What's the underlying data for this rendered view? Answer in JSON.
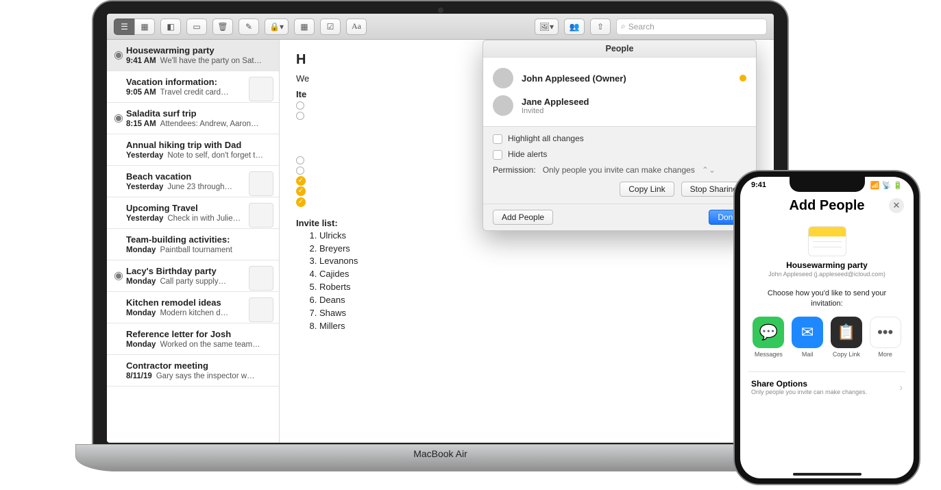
{
  "macbook_label": "MacBook Air",
  "toolbar": {
    "search_placeholder": "Search"
  },
  "sidebar": [
    {
      "title": "Housewarming party",
      "time": "9:41 AM",
      "snippet": "We'll have the party on Sat…",
      "shared": true,
      "selected": true,
      "thumb": false
    },
    {
      "title": "Vacation information:",
      "time": "9:05 AM",
      "snippet": "Travel credit card…",
      "shared": false,
      "thumb": true
    },
    {
      "title": "Saladita surf trip",
      "time": "8:15 AM",
      "snippet": "Attendees: Andrew, Aaron…",
      "shared": true,
      "thumb": false
    },
    {
      "title": "Annual hiking trip with Dad",
      "time": "Yesterday",
      "snippet": "Note to self, don't forget t…",
      "shared": false,
      "thumb": false
    },
    {
      "title": "Beach vacation",
      "time": "Yesterday",
      "snippet": "June 23 through…",
      "shared": false,
      "thumb": true
    },
    {
      "title": "Upcoming Travel",
      "time": "Yesterday",
      "snippet": "Check in with Julie…",
      "shared": false,
      "thumb": true
    },
    {
      "title": "Team-building activities:",
      "time": "Monday",
      "snippet": "Paintball tournament",
      "shared": false,
      "thumb": false
    },
    {
      "title": "Lacy's Birthday party",
      "time": "Monday",
      "snippet": "Call party supply…",
      "shared": true,
      "thumb": true
    },
    {
      "title": "Kitchen remodel ideas",
      "time": "Monday",
      "snippet": "Modern kitchen d…",
      "shared": false,
      "thumb": true
    },
    {
      "title": "Reference letter for Josh",
      "time": "Monday",
      "snippet": "Worked on the same team…",
      "shared": false,
      "thumb": false
    },
    {
      "title": "Contractor meeting",
      "time": "8/11/19",
      "snippet": "Gary says the inspector w…",
      "shared": false,
      "thumb": false
    }
  ],
  "note": {
    "heading_visible": "H",
    "body_visible": "We",
    "items_label": "Ite",
    "invite_label": "Invite list:",
    "invitees": [
      "Ulricks",
      "Breyers",
      "Levanons",
      "Cajides",
      "Roberts",
      "Deans",
      "Shaws",
      "Millers"
    ]
  },
  "popover": {
    "title": "People",
    "people": [
      {
        "name": "John Appleseed (Owner)",
        "sub": "",
        "status": true
      },
      {
        "name": "Jane Appleseed",
        "sub": "Invited",
        "status": false
      }
    ],
    "highlight_label": "Highlight all changes",
    "hide_alerts_label": "Hide alerts",
    "permission_label": "Permission:",
    "permission_value": "Only people you invite can make changes",
    "copy_link": "Copy Link",
    "stop_sharing": "Stop Sharing",
    "add_people": "Add People",
    "done": "Done"
  },
  "iphone": {
    "time": "9:41",
    "title": "Add People",
    "note_title": "Housewarming party",
    "note_sub": "John Appleseed (j.appleseed@icloud.com)",
    "prompt": "Choose how you'd like to send your invitation:",
    "actions": {
      "messages": "Messages",
      "mail": "Mail",
      "copylink": "Copy Link",
      "more": "More"
    },
    "share_options_title": "Share Options",
    "share_options_sub": "Only people you invite can make changes."
  }
}
